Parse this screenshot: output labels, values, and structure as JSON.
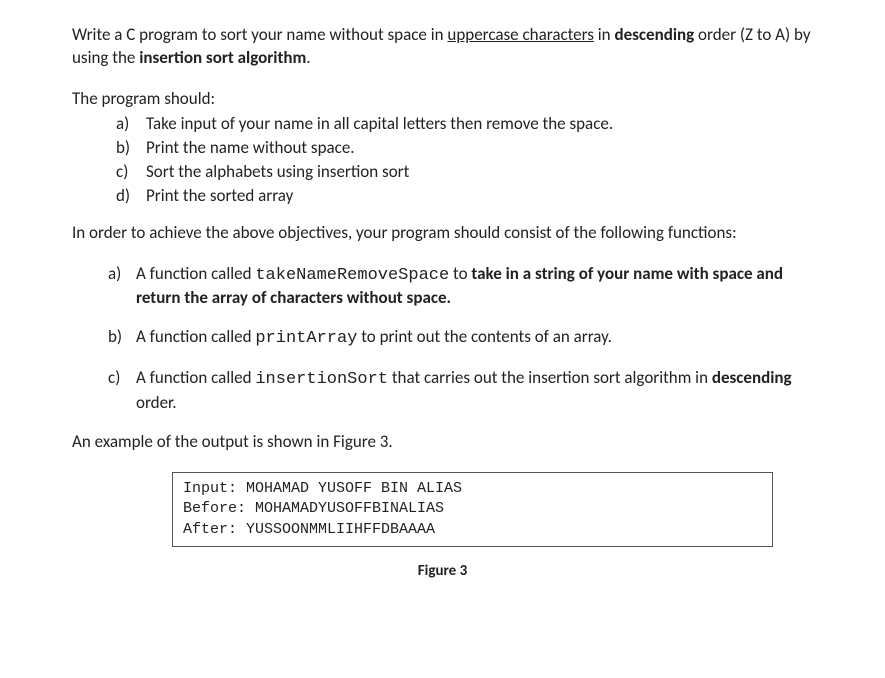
{
  "intro": {
    "part1": "Write a C program to sort your name without space in ",
    "underlined": "uppercase characters",
    "part2": " in ",
    "bold1": "descending",
    "part3": " order (Z to A) by using the ",
    "bold2": "insertion sort algorithm",
    "part4": "."
  },
  "program_should": {
    "header": "The program should:",
    "items": [
      {
        "marker": "a)",
        "text": "Take input of your name in all capital letters then remove the space."
      },
      {
        "marker": "b)",
        "text": "Print the name without space."
      },
      {
        "marker": "c)",
        "text": "Sort the alphabets using insertion sort"
      },
      {
        "marker": "d)",
        "text": "Print the sorted array"
      }
    ]
  },
  "objectives_text": "In order to achieve the above objectives, your program should consist of the following functions:",
  "functions": [
    {
      "marker": "a)",
      "p1": "A function called ",
      "code": "takeNameRemoveSpace",
      "p2": " to ",
      "bold": "take in a string of your name with space and return the array of characters without space."
    },
    {
      "marker": "b)",
      "p1": "A function called ",
      "code": "printArray",
      "p2": " to print out the contents of an array.",
      "bold": ""
    },
    {
      "marker": "c)",
      "p1": "A function called ",
      "code": "insertionSort",
      "p2": " that carries out the insertion sort algorithm in ",
      "bold": "descending",
      "p3": " order."
    }
  ],
  "example_text": "An example of the output is shown in Figure 3.",
  "output": {
    "line1": "Input: MOHAMAD YUSOFF BIN ALIAS",
    "line2": "Before: MOHAMADYUSOFFBINALIAS",
    "line3": "After: YUSSOONMMLIIHFFDBAAAA"
  },
  "figure_caption": "Figure 3"
}
